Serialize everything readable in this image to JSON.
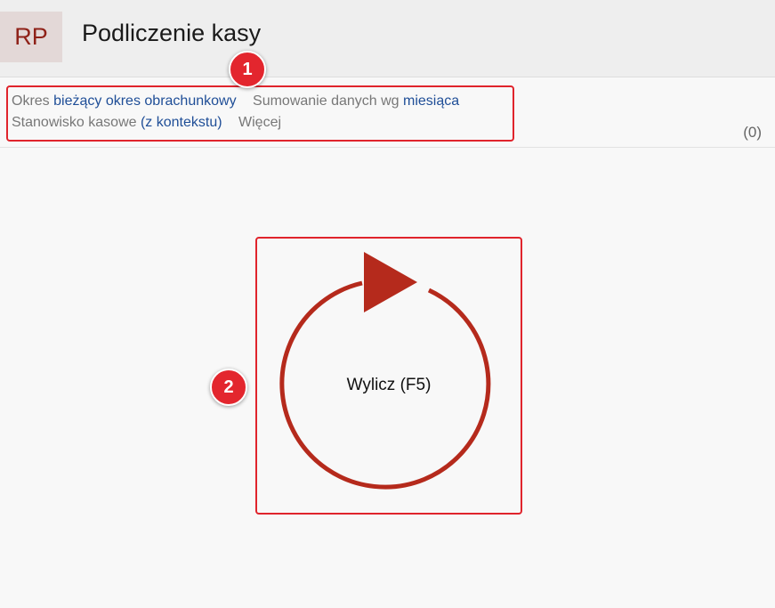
{
  "header": {
    "app_badge": "RP",
    "title": "Podliczenie kasy"
  },
  "filters": {
    "period_label": "Okres",
    "period_value": "bieżący okres obrachunkowy",
    "sum_label": "Sumowanie danych wg",
    "sum_value": "miesiąca",
    "station_label": "Stanowisko kasowe",
    "station_value": "(z kontekstu)",
    "more_label": "Więcej",
    "count": "(0)"
  },
  "calculate": {
    "label": "Wylicz (F5)",
    "icon": "refresh-arrow-icon",
    "color": "#b52a1c"
  },
  "annotations": {
    "first": "1",
    "second": "2",
    "color": "#e0242c"
  }
}
